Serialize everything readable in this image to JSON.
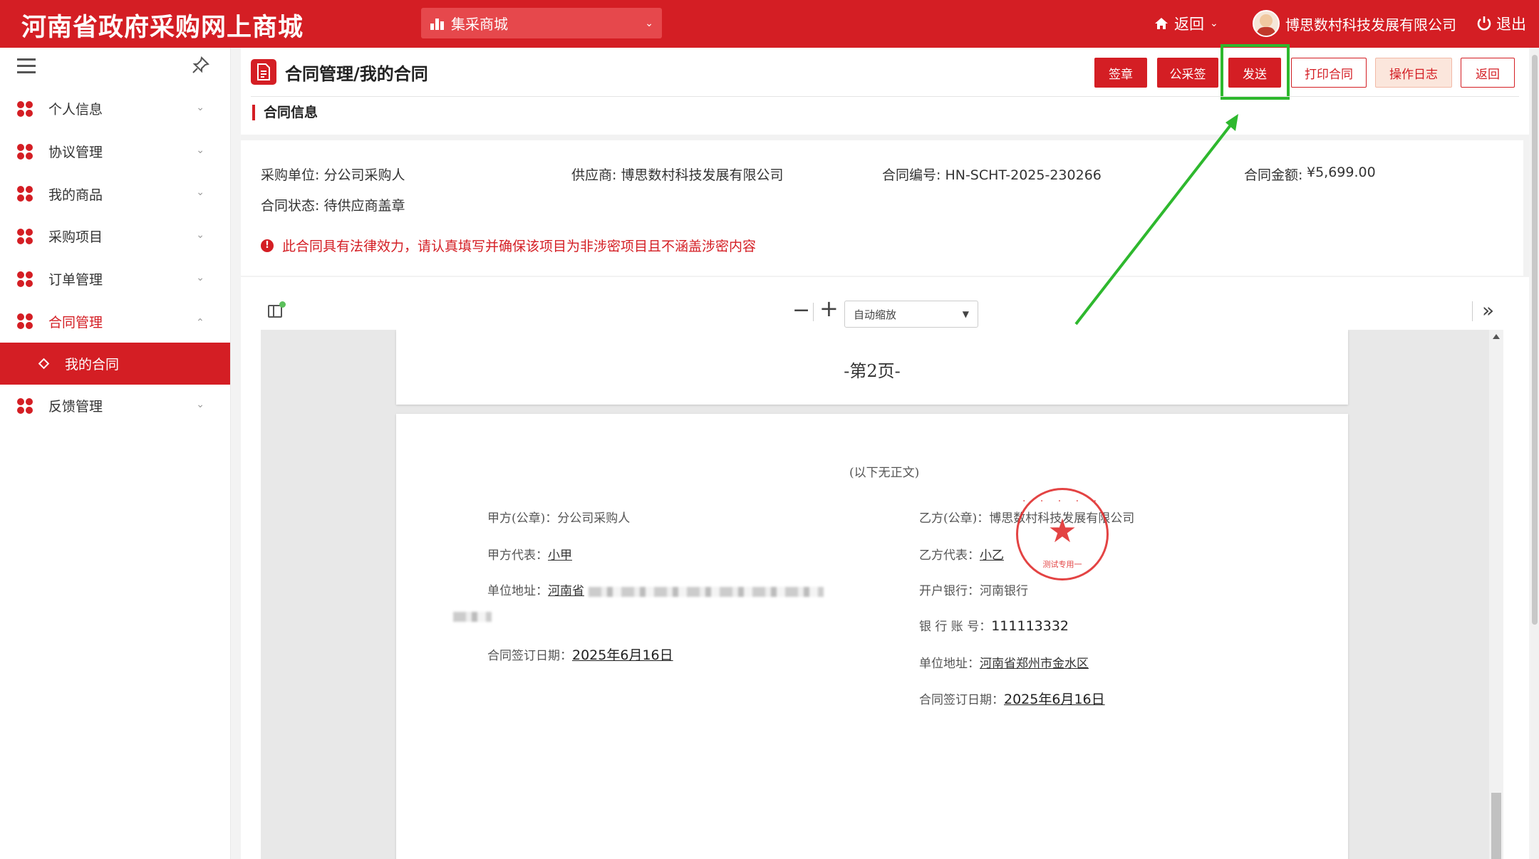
{
  "header": {
    "site_title": "河南省政府采购网上商城",
    "mall_selector": "集采商城",
    "return_label": "返回",
    "user_name": "博思数村科技发展有限公司",
    "logout_label": "退出"
  },
  "sidebar": {
    "items": [
      {
        "label": "个人信息"
      },
      {
        "label": "协议管理"
      },
      {
        "label": "我的商品"
      },
      {
        "label": "采购项目"
      },
      {
        "label": "订单管理"
      },
      {
        "label": "合同管理"
      },
      {
        "label": "反馈管理"
      }
    ],
    "sub_item": "我的合同"
  },
  "page": {
    "title": "合同管理/我的合同",
    "buttons": {
      "sign": "签章",
      "public_sign": "公采签",
      "send": "发送",
      "print": "打印合同",
      "log": "操作日志",
      "back": "返回"
    },
    "section_title": "合同信息"
  },
  "info": {
    "purchaser": "采购单位: 分公司采购人",
    "supplier": "供应商: 博思数村科技发展有限公司",
    "contract_no": "合同编号: HN-SCHT-2025-230266",
    "amount_label": "合同金额:",
    "amount_value": "¥5,699.00",
    "status": "合同状态: 待供应商盖章",
    "warning": "此合同具有法律效力，请认真填写并确保该项目为非涉密项目且不涵盖涉密内容"
  },
  "viewer": {
    "zoom": "自动缩放",
    "page_number": "-第2页-",
    "doc": {
      "no_more": "(以下无正文)",
      "party_a_label": "甲方(公章)：",
      "party_a": "分公司采购人",
      "rep_a_label": "甲方代表：",
      "rep_a": "小甲",
      "addr_a_label": "单位地址：",
      "addr_a": "河南省",
      "date_a_label": "合同签订日期：",
      "date_a": "2025年6月16日",
      "party_b_label": "乙方(公章)：",
      "party_b": "博思数村科技发展有限公司",
      "rep_b_label": "乙方代表：",
      "rep_b": "小乙",
      "bank_label": "开户银行：",
      "bank": "河南银行",
      "account_label": "银 行 账 号：",
      "account": "111113332",
      "addr_b_label": "单位地址：",
      "addr_b": "河南省郑州市金水区",
      "date_b_label": "合同签订日期：",
      "date_b": "2025年6月16日",
      "stamp_text": "测试专用一"
    }
  },
  "colors": {
    "brand": "#d41e24",
    "highlight": "#2eb82e"
  }
}
